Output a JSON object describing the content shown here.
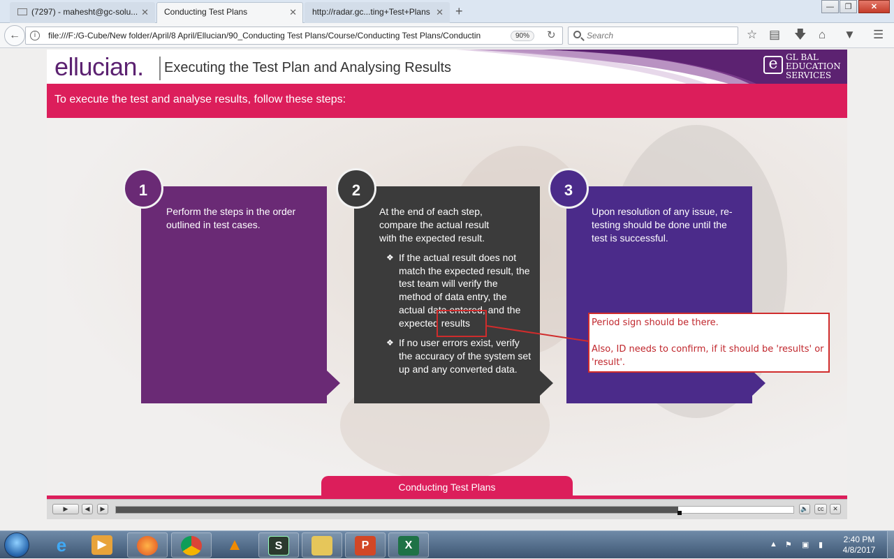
{
  "browser": {
    "tabs": [
      {
        "label": "(7297) - mahesht@gc-solu...",
        "icon": "mail-icon",
        "active": false
      },
      {
        "label": "Conducting Test Plans",
        "active": true
      },
      {
        "label": "http://radar.gc...ting+Test+Plans",
        "active": false
      }
    ],
    "new_tab": "+",
    "close_glyph": "✕",
    "window_buttons": {
      "minimize": "—",
      "maximize": "❐",
      "close": "✕"
    },
    "url": "file:///F:/G-Cube/New folder/April/8 April/Ellucian/90_Conducting Test Plans/Course/Conducting Test Plans/Conductin",
    "zoom": "90%",
    "search_placeholder": "Search",
    "toolbar_icons": [
      "bookmark-star-icon",
      "reading-list-icon",
      "download-icon",
      "home-icon",
      "pocket-icon",
      "menu-icon"
    ]
  },
  "course": {
    "logo": "ellucian.",
    "title": "Executing the Test Plan and Analysing Results",
    "ges_logo": {
      "mark": "e",
      "line1": "GL BAL",
      "line2": "EDUCATION",
      "line3": "SERVICES"
    },
    "intro": "To execute the test and analyse results, follow these steps:",
    "steps": [
      {
        "number": "1",
        "lead": "Perform the steps in the order outlined in test cases.",
        "color": "#6a2a75",
        "bullets": []
      },
      {
        "number": "2",
        "lead": "At the end of each step, compare the actual result with the expected result.",
        "color": "#3b3b3b",
        "bullets": [
          "If the actual result does not match the expected result, the test team will verify the method of data entry, the actual data entered, and the expected results",
          "If no user errors exist, verify the accuracy of the system set up and any converted data."
        ]
      },
      {
        "number": "3",
        "lead": "Upon resolution of any issue, re-testing should be done until the test is successful.",
        "color": "#4b2b8a",
        "bullets": []
      }
    ],
    "bottom_tab": "Conducting Test Plans",
    "player": {
      "progress_fraction": 0.83,
      "buttons": [
        "play-button",
        "prev-button",
        "next-button",
        "volume-button",
        "cc-button",
        "close-button"
      ]
    }
  },
  "review_comment": {
    "line1": "Period sign should be there.",
    "line2": "Also, ID needs to confirm, if it should be 'results' or 'result'."
  },
  "taskbar": {
    "apps": [
      "ie-icon",
      "media-player-icon",
      "firefox-icon",
      "chrome-icon",
      "vlc-icon",
      "sumatra-icon",
      "file-explorer-icon",
      "powerpoint-icon",
      "excel-icon"
    ],
    "time": "2:40 PM",
    "date": "4/8/2017"
  },
  "colors": {
    "accent_pink": "#dc1e5b",
    "ellucian_purple": "#5c2271",
    "review_red": "#d02c2c"
  }
}
